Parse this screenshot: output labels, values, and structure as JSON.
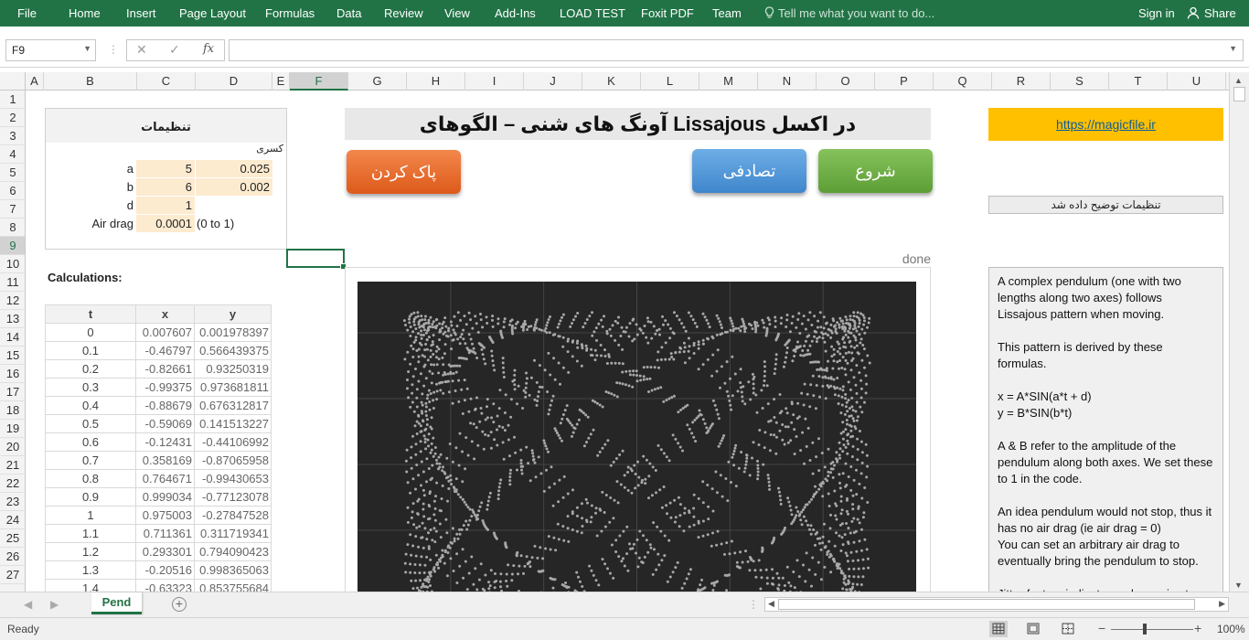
{
  "ribbon": {
    "tabs": [
      "File",
      "Home",
      "Insert",
      "Page Layout",
      "Formulas",
      "Data",
      "Review",
      "View",
      "Add-Ins",
      "LOAD TEST",
      "Foxit PDF",
      "Team"
    ],
    "tell_me": "Tell me what you want to do...",
    "sign_in": "Sign in",
    "share": "Share",
    "bg_color": "#217346"
  },
  "formula_bar": {
    "name_box": "F9",
    "formula": "",
    "fx": "fx",
    "cancel": "✕",
    "enter": "✓"
  },
  "grid": {
    "columns": [
      "A",
      "B",
      "C",
      "D",
      "E",
      "F",
      "G",
      "H",
      "I",
      "J",
      "K",
      "L",
      "M",
      "N",
      "O",
      "P",
      "Q",
      "R",
      "S",
      "T",
      "U"
    ],
    "selected_column": "F",
    "rows": [
      "1",
      "2",
      "3",
      "4",
      "5",
      "6",
      "7",
      "8",
      "9",
      "10",
      "11",
      "12",
      "13",
      "14",
      "15",
      "16",
      "17",
      "18",
      "19",
      "20",
      "21",
      "22",
      "23",
      "24",
      "25",
      "26",
      "27"
    ],
    "selected_row": "9"
  },
  "settings": {
    "title": "تنظیمات",
    "sub_label": "کسری",
    "a_label": "a",
    "a_value": "5",
    "a_frac": "0.025",
    "b_label": "b",
    "b_value": "6",
    "b_frac": "0.002",
    "d_label": "d",
    "d_value": "1",
    "drag_label": "Air drag",
    "drag_value": "0.0001",
    "drag_range": "(0 to 1)"
  },
  "title": "آونگ های شنی – الگوهای Lissajous در اکسل",
  "buttons": {
    "clear": "پاک کردن",
    "random": "تصادفی",
    "start": "شروع"
  },
  "link": "https://magicfile.ir",
  "settings_note": "تنظیمات توضیح داده شد",
  "status_done": "done",
  "calculations_label": "Calculations:",
  "table": {
    "headers": [
      "t",
      "x",
      "y"
    ],
    "rows": [
      [
        "0",
        "0.007607",
        "0.001978397"
      ],
      [
        "0.1",
        "-0.46797",
        "0.566439375"
      ],
      [
        "0.2",
        "-0.82661",
        "0.93250319"
      ],
      [
        "0.3",
        "-0.99375",
        "0.973681811"
      ],
      [
        "0.4",
        "-0.88679",
        "0.676312817"
      ],
      [
        "0.5",
        "-0.59069",
        "0.141513227"
      ],
      [
        "0.6",
        "-0.12431",
        "-0.44106992"
      ],
      [
        "0.7",
        "0.358169",
        "-0.87065958"
      ],
      [
        "0.8",
        "0.764671",
        "-0.99430653"
      ],
      [
        "0.9",
        "0.999034",
        "-0.77123078"
      ],
      [
        "1",
        "0.975003",
        "-0.27847528"
      ],
      [
        "1.1",
        "0.711361",
        "0.311719341"
      ],
      [
        "1.2",
        "0.293301",
        "0.794090423"
      ],
      [
        "1.3",
        "-0.20516",
        "0.998365063"
      ],
      [
        "1.4",
        "-0.63323",
        "0.853755684"
      ]
    ]
  },
  "chart_data": {
    "type": "scatter",
    "title": "",
    "xlabel": "",
    "ylabel": "",
    "grid": true,
    "background": "#262626",
    "point_color": "#a8a8a8",
    "formula": {
      "a": 5,
      "b": 6,
      "d": 1,
      "air_drag": 0.0001
    }
  },
  "description": "A complex pendulum (one with two lengths along two axes) follows Lissajous pattern when moving.\n\nThis pattern is derived by these formulas.\n\nx = A*SIN(a*t + d)\ny = B*SIN(b*t)\n\nA & B refer to the amplitude of the pendulum along both axes. We set these to 1 in the code.\n\nAn idea pendulum would not stop, thus it has no air drag (ie air drag = 0)\nYou can set an arbitrary air drag to eventually bring the pendulum to stop.\n\nJitter factors indicate random noise to",
  "sheet_tabs": [
    "Pend"
  ],
  "status_bar": {
    "ready": "Ready",
    "zoom": "100%",
    "zoom_minus": "−",
    "zoom_plus": "+"
  }
}
